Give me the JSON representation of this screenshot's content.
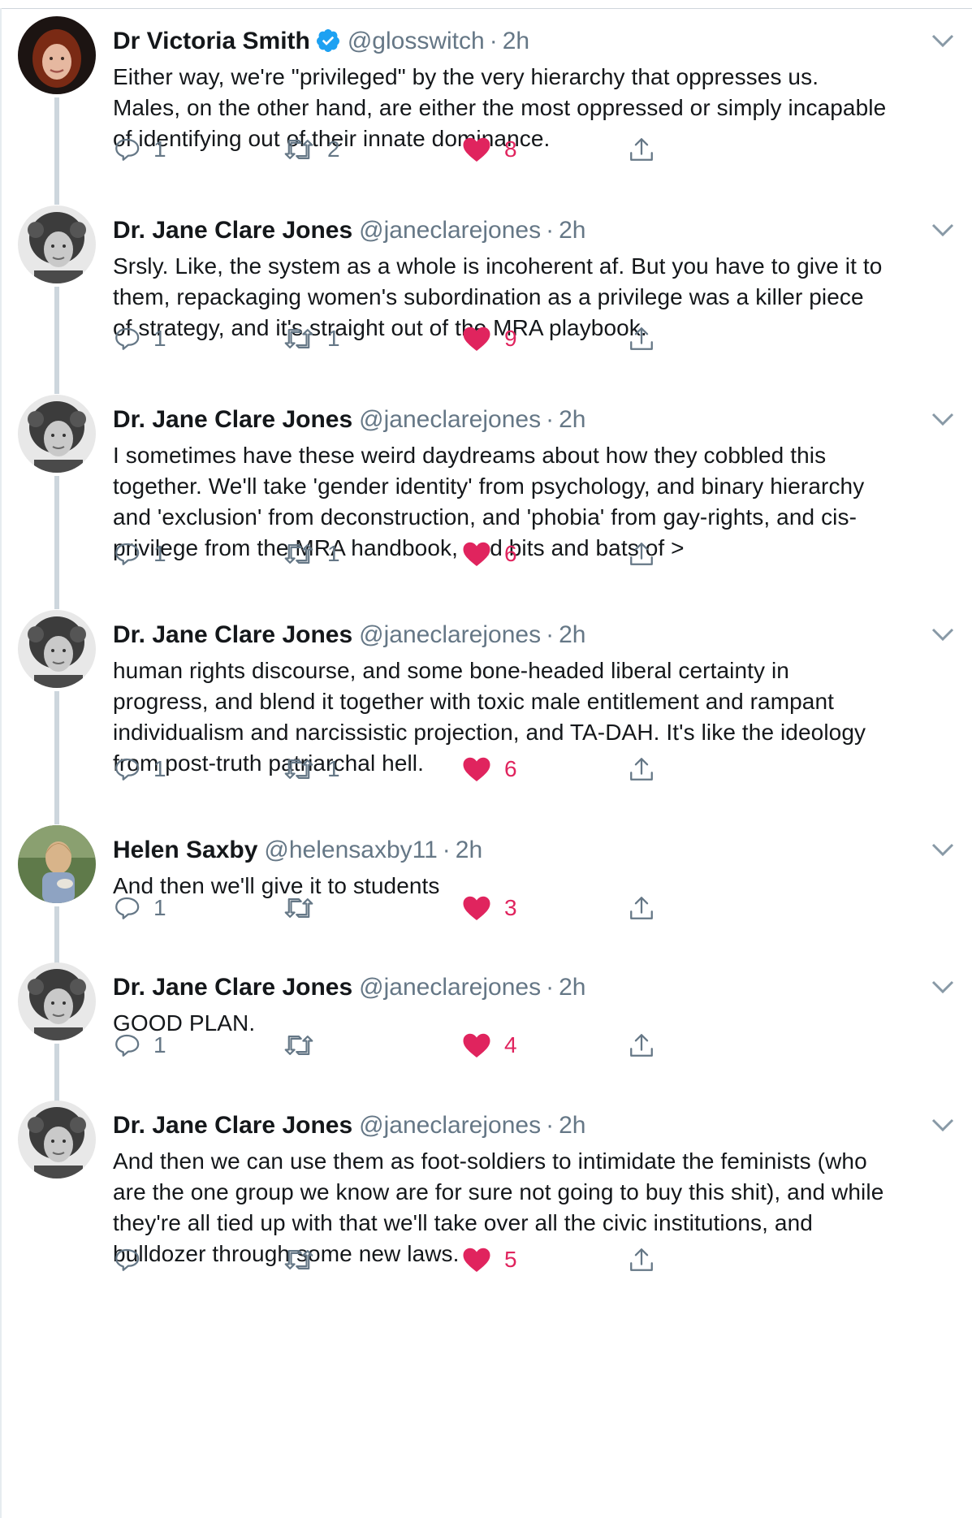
{
  "tweets": [
    {
      "name": "Dr Victoria Smith",
      "verified": true,
      "handle": "@glosswitch",
      "time": "2h",
      "text": "Either way, we're \"privileged\" by the very hierarchy that oppresses us.\nMales, on the other hand, are either the most oppressed or simply incapable\nof identifying out of their innate dominance.",
      "replies": "1",
      "retweets": "2",
      "likes": "8",
      "liked": true
    },
    {
      "name": "Dr. Jane Clare Jones",
      "verified": false,
      "handle": "@janeclarejones",
      "time": "2h",
      "text": "Srsly. Like, the system as a whole is incoherent af. But you have to give it to\nthem, repackaging women's subordination as a privilege was a killer piece\nof strategy, and it's straight out of the MRA playbook.",
      "replies": "1",
      "retweets": "1",
      "likes": "9",
      "liked": true
    },
    {
      "name": "Dr. Jane Clare Jones",
      "verified": false,
      "handle": "@janeclarejones",
      "time": "2h",
      "text": "I sometimes have these weird daydreams about how they cobbled this\ntogether. We'll take 'gender identity' from psychology, and binary hierarchy\nand 'exclusion' from deconstruction, and 'phobia' from gay-rights, and cis-\nprivilege from the MRA handbook, and bits and bats of >",
      "replies": "1",
      "retweets": "1",
      "likes": "6",
      "liked": true
    },
    {
      "name": "Dr. Jane Clare Jones",
      "verified": false,
      "handle": "@janeclarejones",
      "time": "2h",
      "text": "human rights discourse, and some bone-headed liberal certainty in\nprogress, and blend it together with toxic male entitlement and rampant\nindividualism and narcissistic projection, and TA-DAH. It's like the ideology\nfrom post-truth patriarchal hell.",
      "replies": "1",
      "retweets": "1",
      "likes": "6",
      "liked": true
    },
    {
      "name": "Helen Saxby",
      "verified": false,
      "handle": "@helensaxby11",
      "time": "2h",
      "text": "And then we'll give it to students",
      "replies": "1",
      "retweets": "",
      "likes": "3",
      "liked": true
    },
    {
      "name": "Dr. Jane Clare Jones",
      "verified": false,
      "handle": "@janeclarejones",
      "time": "2h",
      "text": "GOOD PLAN.",
      "replies": "1",
      "retweets": "",
      "likes": "4",
      "liked": true
    },
    {
      "name": "Dr. Jane Clare Jones",
      "verified": false,
      "handle": "@janeclarejones",
      "time": "2h",
      "text": "And then we can use them as foot-soldiers to intimidate the feminists (who\nare the one group we know are for sure not going to buy this shit), and while\nthey're all tied up with that we'll take over all the civic institutions, and\nbulldozer through some new laws.",
      "replies": "",
      "retweets": "",
      "likes": "5",
      "liked": true
    }
  ],
  "colors": {
    "text": "#14171a",
    "secondary": "#657786",
    "like": "#e0245e",
    "verified": "#1da1f2",
    "thread_line": "#cdd6dd"
  },
  "icons": {
    "reply": "reply-icon",
    "retweet": "retweet-icon",
    "like": "heart-icon",
    "share": "share-icon",
    "menu": "chevron-down-icon",
    "verified": "verified-badge-icon"
  }
}
